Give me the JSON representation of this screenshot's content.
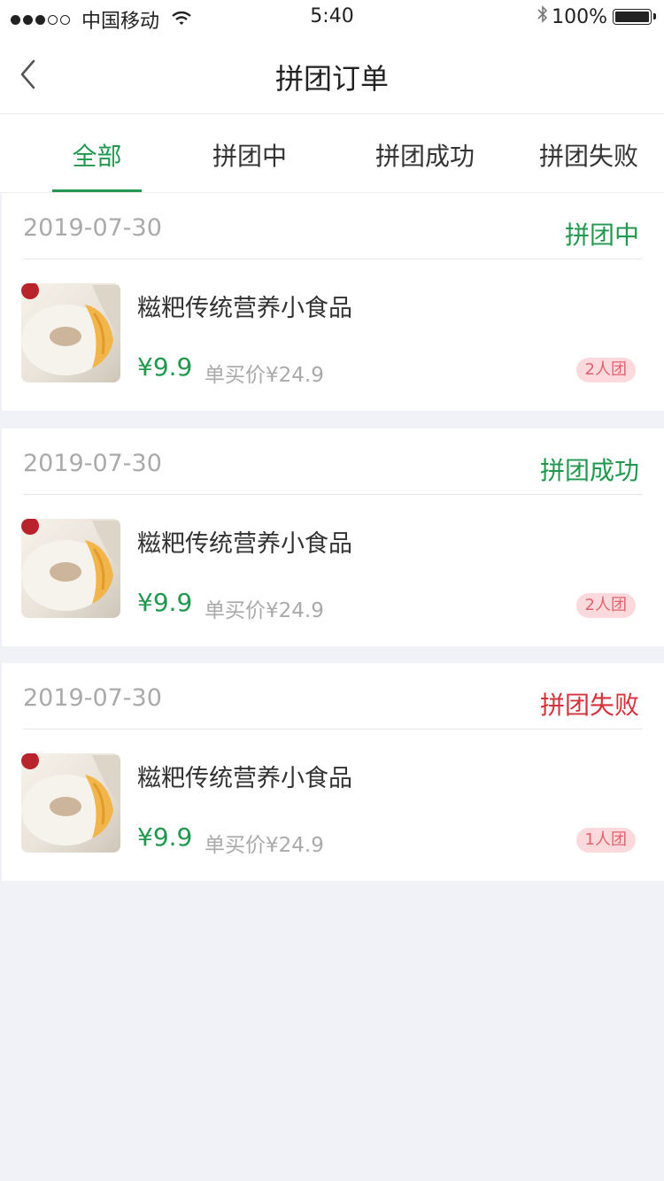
{
  "status_bar": {
    "carrier": "中国移动",
    "time": "5:40",
    "battery": "100%"
  },
  "header": {
    "title": "拼团订单"
  },
  "tabs": [
    {
      "label": "全部",
      "active": true
    },
    {
      "label": "拼团中"
    },
    {
      "label": "拼团成功"
    },
    {
      "label": "拼团失败"
    }
  ],
  "colors": {
    "accent": "#22984f",
    "fail": "#d4333c",
    "badge_bg": "#fbd9dc",
    "badge_text": "#e0646f"
  },
  "orders": [
    {
      "date": "2019-07-30",
      "status": "拼团中",
      "status_color": "#22984f",
      "product": "糍粑传统营养小食品",
      "price": "¥9.9",
      "original_price": "单买价¥24.9",
      "group_size": "2人团"
    },
    {
      "date": "2019-07-30",
      "status": "拼团成功",
      "status_color": "#22984f",
      "product": "糍粑传统营养小食品",
      "price": "¥9.9",
      "original_price": "单买价¥24.9",
      "group_size": "2人团"
    },
    {
      "date": "2019-07-30",
      "status": "拼团失败",
      "status_color": "#d4333c",
      "product": "糍粑传统营养小食品",
      "price": "¥9.9",
      "original_price": "单买价¥24.9",
      "group_size": "1人团"
    }
  ]
}
